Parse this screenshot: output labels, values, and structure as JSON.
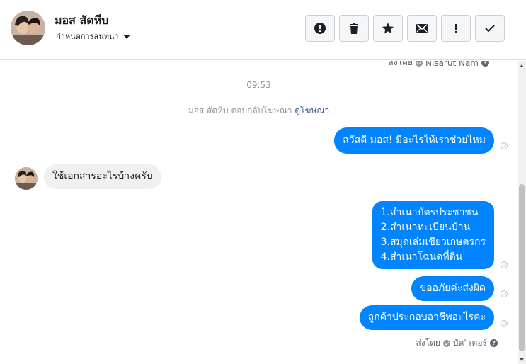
{
  "header": {
    "contact_name": "มอส สัดหีบ",
    "subtitle": "กำหนดการสนทนา",
    "toolbar": [
      {
        "name": "report-spam-icon"
      },
      {
        "name": "trash-icon"
      },
      {
        "name": "star-icon"
      },
      {
        "name": "envelope-icon"
      },
      {
        "name": "exclamation-icon",
        "glyph": "!"
      },
      {
        "name": "checkmark-icon"
      }
    ]
  },
  "conversation": {
    "top_sent_by_label": "ส่งโดย",
    "top_sent_by_name": "Nisarut Nam",
    "timestamp": "09:53",
    "ad_reply_text": "มอส สัดหีบ ตอบกลับโฆษณา",
    "ad_link": "ดูโฆษณา",
    "messages": [
      {
        "direction": "out",
        "lines": [
          "สวัสดี มอส! มีอะไรให้เราช่วยไหม"
        ]
      },
      {
        "direction": "in",
        "lines": [
          "ใช้เอกสารอะไรบ้างครับ"
        ]
      },
      {
        "direction": "out",
        "lines": [
          "1.สำเนาบัตรประชาชน",
          "2.สำเนาทะเบียนบ้าน",
          "3.สมุดเล่มเขียวเกษตรกร",
          "4.สำเนาโฉนดที่ดิน"
        ]
      },
      {
        "direction": "out",
        "lines": [
          "ขออภัยค่ะส่งผิด"
        ]
      },
      {
        "direction": "out",
        "lines": [
          "ลูกค้าประกอบอาชีพอะไรคะ"
        ]
      }
    ],
    "bottom_sent_by_label": "ส่งโดย",
    "bottom_sent_by_name": "บัต' เตอร์"
  },
  "colors": {
    "outgoing_bubble": "#0084ff",
    "incoming_bubble": "#f1f0f0",
    "link": "#385898"
  }
}
